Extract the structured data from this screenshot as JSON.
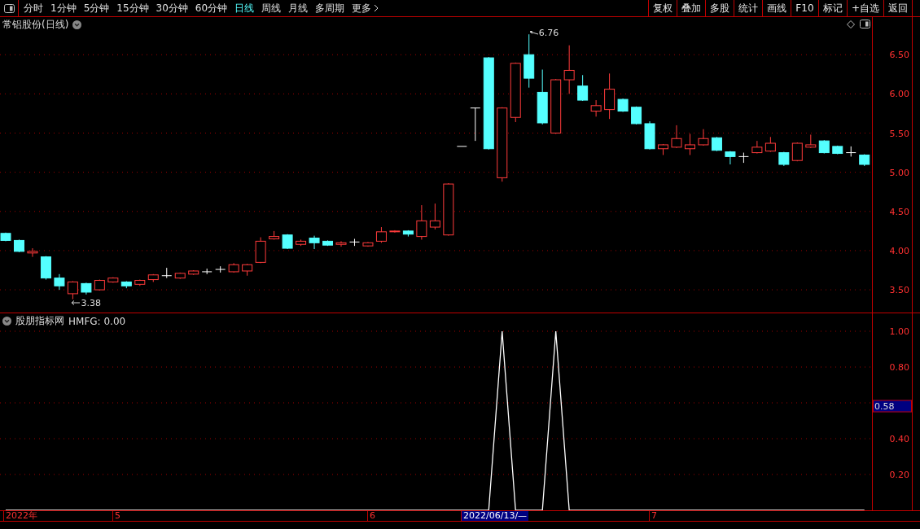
{
  "toolbar": {
    "periods": [
      {
        "label": "分时",
        "selected": false
      },
      {
        "label": "1分钟",
        "selected": false
      },
      {
        "label": "5分钟",
        "selected": false
      },
      {
        "label": "15分钟",
        "selected": false
      },
      {
        "label": "30分钟",
        "selected": false
      },
      {
        "label": "60分钟",
        "selected": false
      },
      {
        "label": "日线",
        "selected": true
      },
      {
        "label": "周线",
        "selected": false
      },
      {
        "label": "月线",
        "selected": false
      },
      {
        "label": "多周期",
        "selected": false
      },
      {
        "label": "更多",
        "selected": false
      }
    ],
    "buttons": [
      "复权",
      "叠加",
      "多股",
      "统计",
      "画线",
      "F10",
      "标记",
      "+自选",
      "返回"
    ]
  },
  "price_panel": {
    "title": "常铝股份(日线)",
    "high_label": "6.76",
    "low_label": "3.38",
    "chart_data": {
      "type": "candlestick",
      "ylim": [
        3.21,
        6.98
      ],
      "grid": true,
      "yticks": [
        {
          "value": 6.5,
          "label": "6.50"
        },
        {
          "value": 6.0,
          "label": "6.00"
        },
        {
          "value": 5.5,
          "label": "5.50"
        },
        {
          "value": 5.0,
          "label": "5.00"
        },
        {
          "value": 4.5,
          "label": "4.50"
        },
        {
          "value": 4.0,
          "label": "4.00"
        },
        {
          "value": 3.5,
          "label": "3.50"
        }
      ],
      "ohlc": [
        [
          4.22,
          4.23,
          4.12,
          4.13
        ],
        [
          4.13,
          4.14,
          3.98,
          3.99
        ],
        [
          3.97,
          4.03,
          3.92,
          3.99
        ],
        [
          3.92,
          3.93,
          3.63,
          3.65
        ],
        [
          3.65,
          3.7,
          3.5,
          3.55
        ],
        [
          3.45,
          3.61,
          3.38,
          3.6
        ],
        [
          3.58,
          3.59,
          3.44,
          3.47
        ],
        [
          3.5,
          3.63,
          3.49,
          3.62
        ],
        [
          3.6,
          3.66,
          3.59,
          3.65
        ],
        [
          3.6,
          3.61,
          3.52,
          3.55
        ],
        [
          3.57,
          3.63,
          3.55,
          3.62
        ],
        [
          3.63,
          3.7,
          3.6,
          3.69
        ],
        [
          3.68,
          3.78,
          3.65,
          3.68
        ],
        [
          3.65,
          3.72,
          3.64,
          3.71
        ],
        [
          3.7,
          3.75,
          3.69,
          3.74
        ],
        [
          3.73,
          3.77,
          3.7,
          3.73
        ],
        [
          3.76,
          3.8,
          3.72,
          3.76
        ],
        [
          3.73,
          3.84,
          3.72,
          3.82
        ],
        [
          3.74,
          3.83,
          3.68,
          3.82
        ],
        [
          3.85,
          4.17,
          3.84,
          4.12
        ],
        [
          4.15,
          4.25,
          4.14,
          4.18
        ],
        [
          4.2,
          4.21,
          4.02,
          4.03
        ],
        [
          4.08,
          4.14,
          4.06,
          4.12
        ],
        [
          4.16,
          4.19,
          4.02,
          4.1
        ],
        [
          4.12,
          4.13,
          4.06,
          4.07
        ],
        [
          4.08,
          4.12,
          4.05,
          4.1
        ],
        [
          4.11,
          4.15,
          4.06,
          4.11
        ],
        [
          4.06,
          4.11,
          4.05,
          4.1
        ],
        [
          4.12,
          4.3,
          4.1,
          4.24
        ],
        [
          4.24,
          4.26,
          4.23,
          4.25
        ],
        [
          4.25,
          4.26,
          4.18,
          4.21
        ],
        [
          4.18,
          4.58,
          4.14,
          4.38
        ],
        [
          4.3,
          4.6,
          4.27,
          4.38
        ],
        [
          4.2,
          4.86,
          4.19,
          4.85
        ],
        [
          5.33,
          5.33,
          5.33,
          5.33
        ],
        [
          5.82,
          5.82,
          5.4,
          5.82
        ],
        [
          6.46,
          6.47,
          5.29,
          5.3
        ],
        [
          4.93,
          5.83,
          4.88,
          5.82
        ],
        [
          5.7,
          6.4,
          5.64,
          6.39
        ],
        [
          6.5,
          6.76,
          6.08,
          6.2
        ],
        [
          6.02,
          6.31,
          5.61,
          5.63
        ],
        [
          5.5,
          6.19,
          5.49,
          6.18
        ],
        [
          6.18,
          6.62,
          6.0,
          6.3
        ],
        [
          6.1,
          6.24,
          5.91,
          5.92
        ],
        [
          5.78,
          5.92,
          5.71,
          5.85
        ],
        [
          5.8,
          6.26,
          5.68,
          6.06
        ],
        [
          5.93,
          5.94,
          5.77,
          5.78
        ],
        [
          5.83,
          5.84,
          5.61,
          5.62
        ],
        [
          5.62,
          5.65,
          5.29,
          5.3
        ],
        [
          5.3,
          5.36,
          5.22,
          5.35
        ],
        [
          5.32,
          5.6,
          5.31,
          5.43
        ],
        [
          5.3,
          5.49,
          5.22,
          5.35
        ],
        [
          5.35,
          5.55,
          5.34,
          5.43
        ],
        [
          5.44,
          5.45,
          5.27,
          5.28
        ],
        [
          5.26,
          5.27,
          5.1,
          5.2
        ],
        [
          5.2,
          5.25,
          5.12,
          5.2
        ],
        [
          5.25,
          5.4,
          5.24,
          5.32
        ],
        [
          5.27,
          5.45,
          5.26,
          5.37
        ],
        [
          5.25,
          5.26,
          5.08,
          5.1
        ],
        [
          5.15,
          5.38,
          5.14,
          5.37
        ],
        [
          5.32,
          5.48,
          5.31,
          5.35
        ],
        [
          5.4,
          5.41,
          5.24,
          5.25
        ],
        [
          5.33,
          5.34,
          5.23,
          5.24
        ],
        [
          5.25,
          5.33,
          5.2,
          5.25
        ],
        [
          5.22,
          5.23,
          5.08,
          5.1
        ]
      ]
    }
  },
  "indicator_panel": {
    "name": "股朋指标网",
    "reading": "HMFG: 0.00",
    "cursor_value": "0.58",
    "chart_data": {
      "type": "line",
      "ylim": [
        0,
        1.1
      ],
      "grid": true,
      "yticks": [
        {
          "value": 0.2,
          "label": "0.20"
        },
        {
          "value": 0.4,
          "label": "0.40"
        },
        {
          "value": 0.8,
          "label": "0.80"
        },
        {
          "value": 1.0,
          "label": "1.00"
        }
      ],
      "series": [
        {
          "color": "#ffffff",
          "values": [
            0,
            0,
            0,
            0,
            0,
            0,
            0,
            0,
            0,
            0,
            0,
            0,
            0,
            0,
            0,
            0,
            0,
            0,
            0,
            0,
            0,
            0,
            0,
            0,
            0,
            0,
            0,
            0,
            0,
            0,
            0,
            0,
            0,
            0,
            0,
            0,
            0,
            1,
            0,
            0,
            0,
            1,
            0,
            0,
            0,
            0,
            0,
            0,
            0,
            0,
            0,
            0,
            0,
            0,
            0,
            0,
            0,
            0,
            0,
            0,
            0,
            0,
            0,
            0,
            0
          ]
        }
      ]
    }
  },
  "time_axis": {
    "labels": [
      {
        "text": "2022年",
        "selected": false
      },
      {
        "text": "5",
        "selected": false
      },
      {
        "text": "6",
        "selected": false
      },
      {
        "text": "2022/06/13/—",
        "selected": true
      },
      {
        "text": "7",
        "selected": false
      }
    ]
  }
}
